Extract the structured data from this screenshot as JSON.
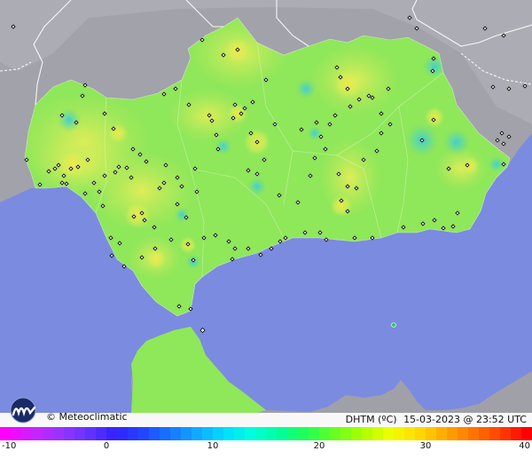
{
  "brand": {
    "name": "© Meteoclimatic",
    "logo_icon": "meteoclimatic-logo-icon"
  },
  "product": {
    "variable": "DHTM (ºC)",
    "timestamp": "15-03-2023 @ 23:52 UTC"
  },
  "scale": {
    "ticks": [
      "-10",
      "0",
      "10",
      "20",
      "30",
      "40"
    ],
    "min": -10,
    "max": 40,
    "colors": [
      "#ff00ff",
      "#cc22ff",
      "#9933ff",
      "#6633ff",
      "#3322ff",
      "#2244ff",
      "#1677ff",
      "#11aaff",
      "#00ddff",
      "#00ffdd",
      "#00ff99",
      "#22ff55",
      "#66ff22",
      "#aaff00",
      "#eeff00",
      "#ffdd00",
      "#ffaa00",
      "#ff7700",
      "#ff4400",
      "#ff0000"
    ]
  },
  "map": {
    "sea_color": "#7b8be0",
    "land_outside_color": "#9b9ba3",
    "region_base_color": "#8fe75a",
    "hotspot_warm_color": "#f0ee55",
    "hotspot_cool_color": "#4fd0c8"
  }
}
